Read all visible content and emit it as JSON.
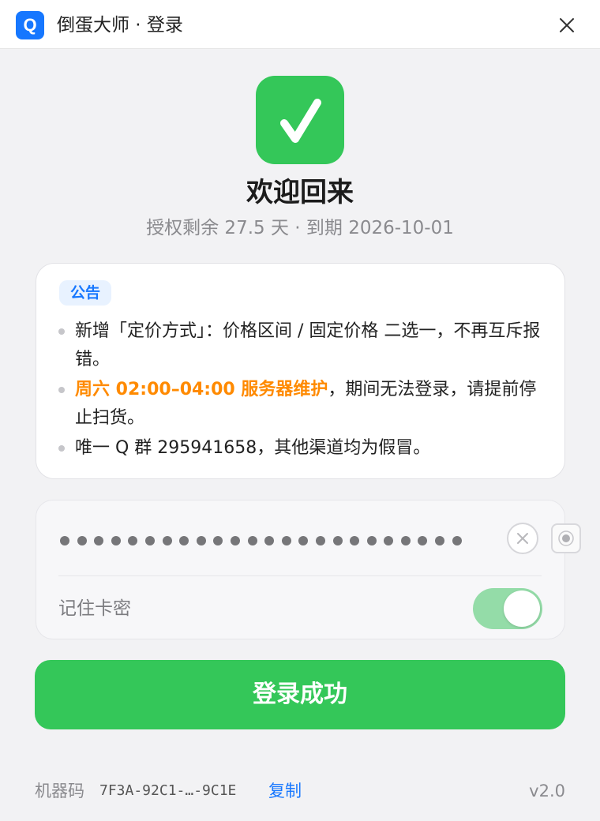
{
  "window": {
    "app_icon_letter": "Q",
    "title": "倒蛋大师 · 登录",
    "close_icon": "close-icon"
  },
  "hero": {
    "icon": "checkmark-icon",
    "title": "欢迎回来",
    "license_info": "授权剩余 27.5 天 · 到期 2026-10-01"
  },
  "notice": {
    "badge": "公告",
    "items": [
      {
        "text": "新增「定价方式」：价格区间 / 固定价格 二选一，不再互斥报错。"
      },
      {
        "highlight": "周六 02:00–04:00 服务器维护",
        "text": "，期间无法登录，请提前停止扫货。"
      },
      {
        "text": "唯一 Q 群 295941658，其他渠道均为假冒。"
      }
    ]
  },
  "login": {
    "password_masked_length": 24,
    "clear_icon": "clear-icon",
    "reveal_icon": "eye-icon",
    "remember_label": "记住卡密",
    "remember_enabled": true,
    "submit_label": "登录成功"
  },
  "footer": {
    "machine_label": "机器码",
    "machine_code": "7F3A-92C1-…-9C1E",
    "copy_label": "复制",
    "version": "v2.0"
  },
  "colors": {
    "accent_green": "#34c759",
    "accent_blue": "#1677ff",
    "warning_orange": "#ff8a00",
    "background": "#f2f2f4"
  }
}
